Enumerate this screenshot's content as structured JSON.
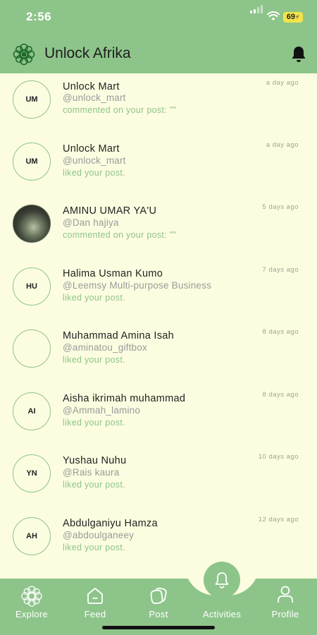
{
  "status": {
    "time": "2:56",
    "battery": "69"
  },
  "header": {
    "title": "Unlock Afrika"
  },
  "notifications": [
    {
      "initials": "UM",
      "name": "Unlock Mart",
      "handle": "@unlock_mart",
      "action": "commented on your post: \"\"",
      "time": "a day ago"
    },
    {
      "initials": "UM",
      "name": "Unlock Mart",
      "handle": "@unlock_mart",
      "action": "liked your post.",
      "time": "a day ago"
    },
    {
      "initials": "",
      "name": "AMINU UMAR YA'U",
      "handle": "@Dan hajiya",
      "action": "commented on your post: \"\"",
      "time": "5 days ago"
    },
    {
      "initials": "HU",
      "name": "Halima Usman Kumo",
      "handle": "@Leemsy Multi-purpose Business",
      "action": "liked your post.",
      "time": "7 days ago"
    },
    {
      "initials": "",
      "name": "Muhammad Amina Isah",
      "handle": "@aminatou_giftbox",
      "action": "liked your post.",
      "time": "8 days ago"
    },
    {
      "initials": "AI",
      "name": "Aisha ikrimah muhammad",
      "handle": "@Ammah_lamino",
      "action": "liked your post.",
      "time": "8 days ago"
    },
    {
      "initials": "YN",
      "name": "Yushau Nuhu",
      "handle": "@Rais kaura",
      "action": "liked your post.",
      "time": "10 days ago"
    },
    {
      "initials": "AH",
      "name": "Abdulganiyu Hamza",
      "handle": "@abdoulganeey",
      "action": "liked your post.",
      "time": "12 days ago"
    }
  ],
  "tabs": [
    {
      "label": "Explore",
      "icon": "mandala-icon"
    },
    {
      "label": "Feed",
      "icon": "home-icon"
    },
    {
      "label": "Post",
      "icon": "post-icon"
    },
    {
      "label": "Activities",
      "icon": "bell-icon"
    },
    {
      "label": "Profile",
      "icon": "user-icon"
    }
  ],
  "colors": {
    "accent": "#8dc48a",
    "background": "#fcfde0"
  }
}
